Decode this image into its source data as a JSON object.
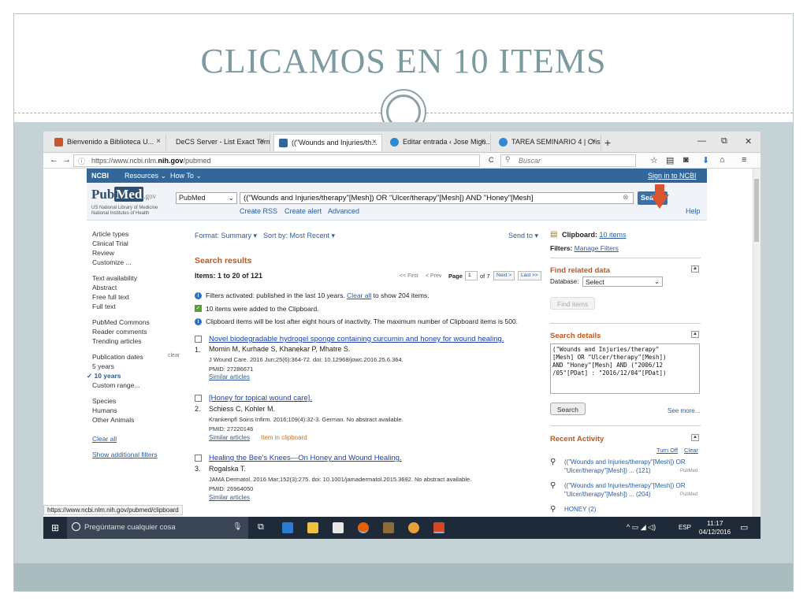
{
  "slide": {
    "title": "CLICAMOS EN 10 ITEMS"
  },
  "browser": {
    "tabs": [
      {
        "label": "Bienvenido a Biblioteca U...",
        "close": "×",
        "color": "#c9552c"
      },
      {
        "label": "DeCS Server - List Exact Term",
        "close": "×",
        "color": "#dddddd"
      },
      {
        "label": "((\"Wounds and Injuries/th...",
        "close": "×",
        "color": "#336699"
      },
      {
        "label": "Editar entrada ‹ Jose Migu...",
        "close": "×",
        "color": "#2e8ad6"
      },
      {
        "label": "TAREA SEMINARIO 4 | Cris...",
        "close": "×",
        "color": "#2e8ad6"
      }
    ],
    "new_tab": "+",
    "window_min": "—",
    "window_restore": "⧉",
    "window_close": "✕",
    "url": "https://www.ncbi.nlm.",
    "url_bold": "nih.gov",
    "url_rest": "/pubmed",
    "search_placeholder": "Buscar",
    "reload": "C",
    "status_url": "https://www.ncbi.nlm.nih.gov/pubmed/clipboard"
  },
  "ncbi": {
    "brand": "NCBI",
    "resources": "Resources ⌄",
    "howto": "How To ⌄",
    "signin": "Sign in to NCBI"
  },
  "pubmed": {
    "logo_pub": "Pub",
    "logo_med": "Med",
    "logo_gov": ".gov",
    "sub1": "US National Library of Medicine",
    "sub2": "National Institutes of Health",
    "db": "PubMed",
    "query": "((\"Wounds and Injuries/therapy\"[Mesh]) OR \"Ulcer/therapy\"[Mesh]) AND \"Honey\"[Mesh]",
    "search_btn": "Sea",
    "create_rss": "Create RSS",
    "create_alert": "Create alert",
    "advanced": "Advanced",
    "help": "Help"
  },
  "filters": {
    "article_types": "Article types",
    "clinical_trial": "Clinical Trial",
    "review": "Review",
    "customize": "Customize ...",
    "text_avail": "Text availability",
    "abstract": "Abstract",
    "free_full": "Free full text",
    "full_text": "Full text",
    "commons": "PubMed Commons",
    "reader": "Reader comments",
    "trending": "Trending articles",
    "pubdates": "Publication dates",
    "clear": "clear",
    "five": "5 years",
    "ten": "✓ 10 years",
    "custom": "Custom range...",
    "species": "Species",
    "humans": "Humans",
    "other_animals": "Other Animals",
    "clear_all": "Clear all",
    "show_more": "Show additional filters"
  },
  "results": {
    "format": "Format: Summary ▾",
    "sort": "Sort by: Most Recent ▾",
    "send_to": "Send to ▾",
    "heading": "Search results",
    "items": "Items: 1 to 20 of 121",
    "first": "<< First",
    "prev": "< Prev",
    "page_label": "Page",
    "page_num": "1",
    "of": "of 7",
    "next": "Next >",
    "last": "Last >>",
    "notice1_a": "Filters activated: published in the last 10 years.",
    "notice1_link": "Clear all",
    "notice1_b": "to show 204 items.",
    "notice2": "10 items were added to the Clipboard.",
    "notice3": "Clipboard items will be lost after eight hours of inactivity. The maximum number of Clipboard items is 500.",
    "entries": [
      {
        "num": "1.",
        "title": "Novel biodegradable hydrogel sponge containing curcumin and honey for wound healing.",
        "authors": "Momin M, Kurhade S, Khanekar P, Mhatre S.",
        "citation": "J Wound Care. 2016 Jun;25(6):364-72. doi: 10.12968/jowc.2016.25.6.364.",
        "pmid": "PMID: 27286671",
        "similar": "Similar articles",
        "clip": ""
      },
      {
        "num": "2.",
        "title": "[Honey for topical wound care].",
        "authors": "Schiess C, Kohler M.",
        "citation": "Krankenpfl Soins Infirm. 2016;109(4):32-3. German. No abstract available.",
        "pmid": "PMID: 27220146",
        "similar": "Similar articles",
        "clip": "Item in clipboard"
      },
      {
        "num": "3.",
        "title": "Healing the Bee's Knees—On Honey and Wound Healing.",
        "authors": "Rogalska T.",
        "citation": "JAMA Dermatol. 2016 Mar;152(3):275. doi: 10.1001/jamadermatol.2015.3692. No abstract available.",
        "pmid": "PMID: 26964050",
        "similar": "Similar articles",
        "clip": ""
      }
    ]
  },
  "sidebar": {
    "clipboard_label": "Clipboard:",
    "clipboard_link": "10 items",
    "filters_label": "Filters:",
    "filters_link": "Manage Filters",
    "related_heading": "Find related data",
    "database_label": "Database:",
    "database_value": "Select",
    "find_items": "Find items",
    "details_heading": "Search details",
    "details_text": "(\"Wounds and Injuries/therapy\"\n[Mesh] OR \"Ulcer/therapy\"[Mesh])\nAND \"Honey\"[Mesh] AND (\"2006/12\n/05\"[PDat] : \"2016/12/04\"[PDat])",
    "details_search_btn": "Search",
    "see_more": "See more...",
    "recent_heading": "Recent Activity",
    "turn_off": "Turn Off",
    "clear": "Clear",
    "recent1_a": "((\"Wounds and Injuries/therapy\"[Mesh]) OR",
    "recent1_b": "\"Ulcer/therapy\"[Mesh]) ... (121)",
    "recent1_src": "PubMed",
    "recent2_a": "((\"Wounds and Injuries/therapy\"[Mesh]) OR",
    "recent2_b": "\"Ulcer/therapy\"[Mesh]) ... (204)",
    "recent2_src": "PubMed",
    "recent3": "HONEY (2)"
  },
  "taskbar": {
    "search_text": "Pregúntame cualquier cosa",
    "lang": "ESP",
    "time": "11:17",
    "date": "04/12/2016"
  }
}
